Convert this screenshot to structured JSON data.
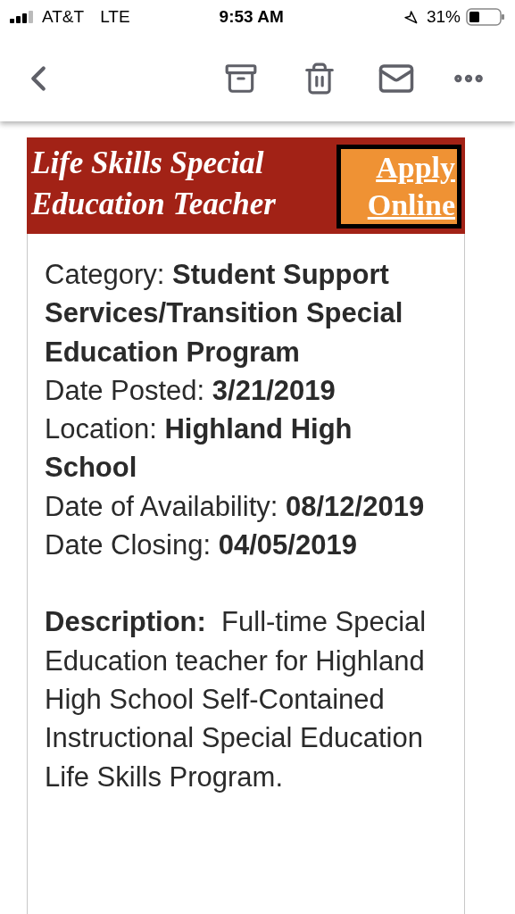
{
  "status_bar": {
    "carrier": "AT&T",
    "network": "LTE",
    "time": "9:53 AM",
    "battery": "31%"
  },
  "header": {
    "title": "Life Skills Special Education Teacher",
    "apply_link": "Apply Online"
  },
  "fields": [
    "Category: **Student Support Services/Transition Special Education Program**",
    "Date Posted: **3/21/2019**",
    "Location: **Highland High School**",
    "Date of Availability: **08/12/2019**",
    "Date Closing: **04/05/2019**"
  ],
  "description": "**Description:**  Full-time Special Education teacher for Highland High School Self-Contained Instructional Special Education Life Skills Program."
}
